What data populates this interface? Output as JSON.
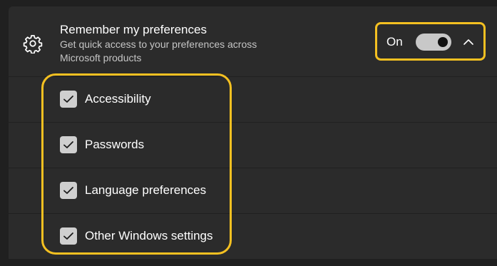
{
  "setting": {
    "title": "Remember my preferences",
    "description": "Get quick access to your preferences across Microsoft products",
    "state_label": "On",
    "toggle_on": true,
    "expanded": true
  },
  "options": [
    {
      "label": "Accessibility",
      "checked": true
    },
    {
      "label": "Passwords",
      "checked": true
    },
    {
      "label": "Language preferences",
      "checked": true
    },
    {
      "label": "Other Windows settings",
      "checked": true
    }
  ],
  "colors": {
    "highlight": "#f4c021",
    "card": "#2b2b2b",
    "background": "#202020"
  },
  "icons": {
    "setting": "gear-icon",
    "expand": "chevron-up-icon",
    "check": "checkmark-icon"
  }
}
